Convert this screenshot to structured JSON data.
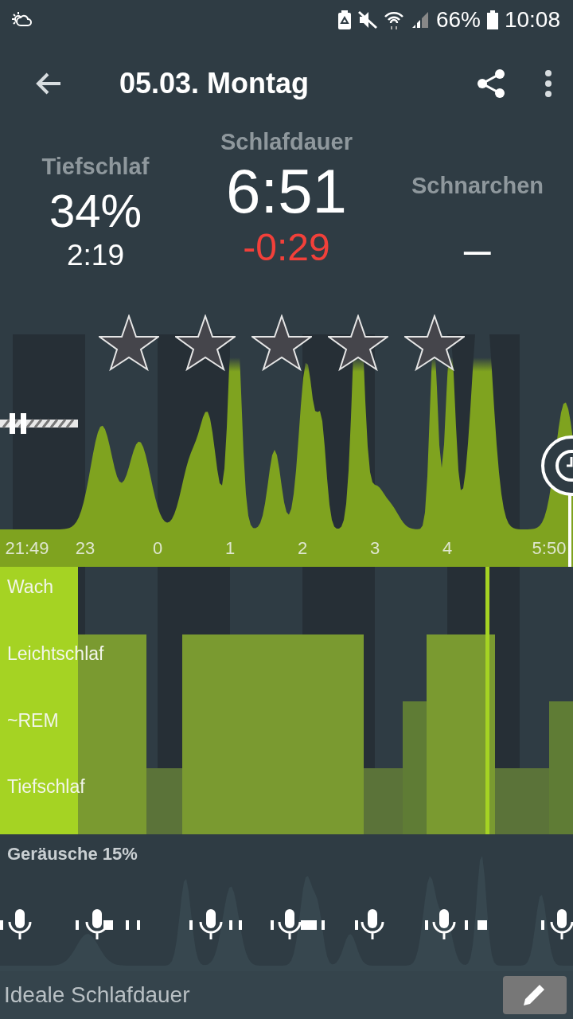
{
  "status_bar": {
    "battery": "66%",
    "time": "10:08"
  },
  "header": {
    "title": "05.03. Montag"
  },
  "stats": [
    {
      "kind": "side",
      "label": "Tiefschlaf",
      "value": "34%",
      "detail": "2:19"
    },
    {
      "kind": "main",
      "label": "Schlafdauer",
      "value": "6:51",
      "detail": "-0:29"
    },
    {
      "kind": "side",
      "label": "Schnarchen",
      "value": "_"
    }
  ],
  "rating": {
    "stars": 0
  },
  "activity": {
    "time_labels": [
      "21:49",
      "23",
      "0",
      "1",
      "2",
      "3",
      "4",
      "5:50"
    ]
  },
  "hypnogram": {
    "stages": [
      "Wach",
      "Leichtschlaf",
      "~REM",
      "Tiefschlaf"
    ]
  },
  "noise": {
    "label": "Geräusche 15%"
  },
  "footer": {
    "label": "Ideale Schlafdauer"
  }
}
